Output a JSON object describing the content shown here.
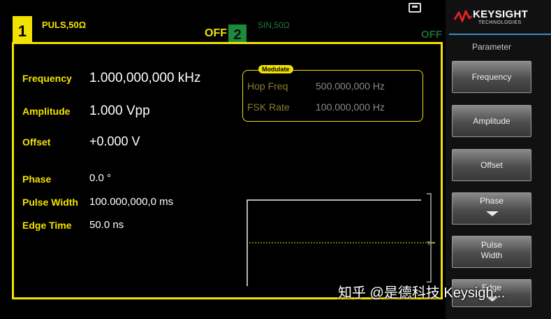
{
  "channel1": {
    "number": "1",
    "name": "PULS,50Ω",
    "output_state": "OFF"
  },
  "channel2": {
    "number": "2",
    "name": "SIN,50Ω",
    "output_state": "OFF"
  },
  "parameters": [
    {
      "label": "Frequency",
      "value": "1.000,000,000 kHz"
    },
    {
      "label": "Amplitude",
      "value": "1.000 Vpp"
    },
    {
      "label": "Offset",
      "value": "+0.000 V"
    },
    {
      "label": "Phase",
      "value": "0.0 °"
    },
    {
      "label": "Pulse Width",
      "value": "100.000,000,0 ms"
    },
    {
      "label": "Edge Time",
      "value": "50.0 ns"
    }
  ],
  "modulate": {
    "tag": "Modulate",
    "rows": [
      {
        "label": "Hop Freq",
        "value": "500.000,000 Hz"
      },
      {
        "label": "FSK Rate",
        "value": "100.000,000 Hz"
      }
    ]
  },
  "sidebar": {
    "brand": "KEYSIGHT",
    "brand_sub": "TECHNOLOGIES",
    "title": "Parameter",
    "softkeys": [
      {
        "label": "Frequency"
      },
      {
        "label": "Amplitude"
      },
      {
        "label": "Offset"
      },
      {
        "label": "Phase"
      },
      {
        "label1": "Pulse",
        "label2": "Width"
      },
      {
        "label": "Edge"
      }
    ]
  },
  "watermark": "知乎 @是德科技 Keysigh...",
  "icons": [
    "usb-icon",
    "keysight-logo-icon",
    "down-arrow-icon"
  ],
  "colors": {
    "channel1": "#f2e200",
    "channel2": "#1c8a3a",
    "accent": "#3a8ec8"
  }
}
